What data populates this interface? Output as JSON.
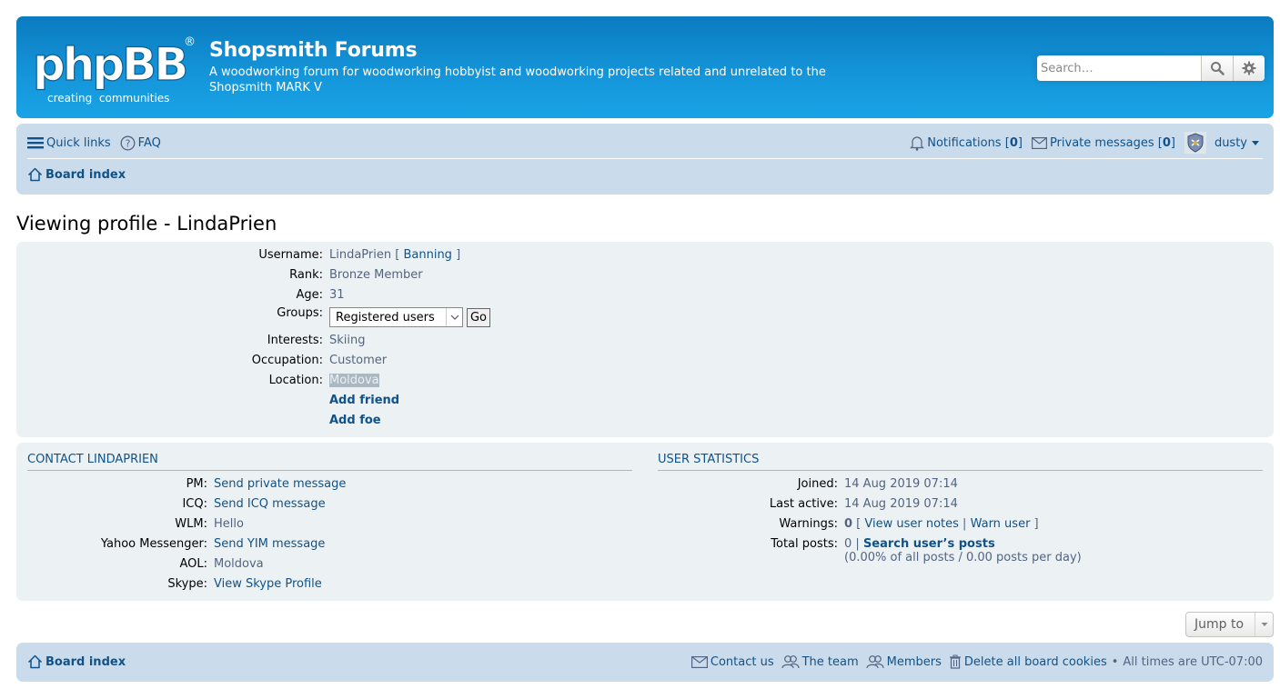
{
  "header": {
    "logo_main": "phpBB",
    "logo_reg": "®",
    "logo_sub": "creating  communities",
    "title": "Shopsmith Forums",
    "description": "A woodworking forum for woodworking hobbyist and woodworking projects related and unrelated to the Shopsmith MARK V",
    "search_placeholder": "Search…"
  },
  "navbar": {
    "quick_links": "Quick links",
    "faq": "FAQ",
    "notifications_label": "Notifications",
    "notifications_count": "0",
    "pm_label": "Private messages",
    "pm_count": "0",
    "username": "dusty",
    "board_index": "Board index"
  },
  "page_title": "Viewing profile - LindaPrien",
  "profile": {
    "username_label": "Username:",
    "username": "LindaPrien",
    "banning": "Banning",
    "rank_label": "Rank:",
    "rank": "Bronze Member",
    "age_label": "Age:",
    "age": "31",
    "groups_label": "Groups:",
    "groups_selected": "Registered users",
    "go": "Go",
    "interests_label": "Interests:",
    "interests": "Skiing",
    "occupation_label": "Occupation:",
    "occupation": "Customer",
    "location_label": "Location:",
    "location": "Moldova",
    "add_friend": "Add friend",
    "add_foe": "Add foe"
  },
  "contact": {
    "title": "Contact LindaPrien",
    "pm_label": "PM:",
    "pm": "Send private message",
    "icq_label": "ICQ:",
    "icq": "Send ICQ message",
    "wlm_label": "WLM:",
    "wlm": "Hello",
    "yahoo_label": "Yahoo Messenger:",
    "yahoo": "Send YIM message",
    "aol_label": "AOL:",
    "aol": "Moldova",
    "skype_label": "Skype:",
    "skype": "View Skype Profile"
  },
  "stats": {
    "title": "User statistics",
    "joined_label": "Joined:",
    "joined": "14 Aug 2019 07:14",
    "last_active_label": "Last active:",
    "last_active": "14 Aug 2019 07:14",
    "warnings_label": "Warnings:",
    "warnings": "0",
    "view_notes": "View user notes",
    "warn_user": "Warn user",
    "total_posts_label": "Total posts:",
    "total_posts": "0",
    "search_posts": "Search user’s posts",
    "posts_ratio": "(0.00% of all posts / 0.00 posts per day)"
  },
  "jump_to": "Jump to",
  "footer": {
    "board_index": "Board index",
    "contact_us": "Contact us",
    "the_team": "The team",
    "members": "Members",
    "delete_cookies": "Delete all board cookies",
    "timezone": "All times are UTC-07:00"
  },
  "colors": {
    "header_blue": "#0b7bc0",
    "nav_bg": "#cadceb",
    "panel_bg": "#ecf1f3",
    "link": "#105289"
  }
}
